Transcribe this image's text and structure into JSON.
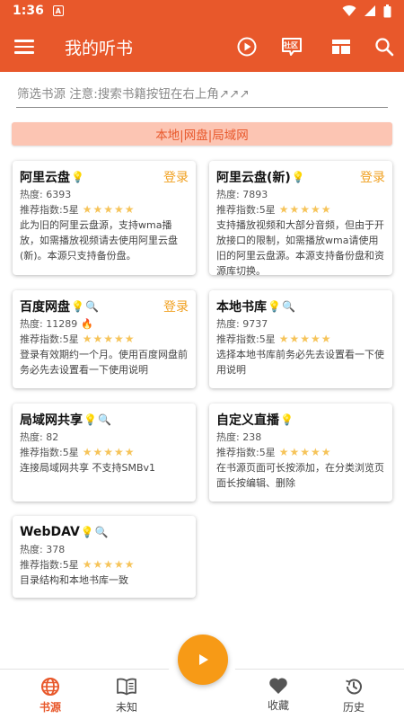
{
  "status": {
    "time": "1:36",
    "notif": "A"
  },
  "appbar": {
    "title": "我的听书",
    "community_label": "社区"
  },
  "filter": {
    "placeholder": "筛选书源 注意:搜索书籍按钮在右上角↗↗↗"
  },
  "banner": {
    "text": "本地|网盘|局域网"
  },
  "cards": [
    {
      "name": "阿里云盘",
      "login": "登录",
      "heat": "热度: 6393",
      "rating": "推荐指数:5星",
      "stars": "★★★★★",
      "desc": "此为旧的阿里云盘源，支持wma播放，如需播放视频请去使用阿里云盘(新)。本源只支持备份盘。"
    },
    {
      "name": "阿里云盘(新)",
      "login": "登录",
      "heat": "热度: 7893",
      "rating": "推荐指数:5星",
      "stars": "★★★★★",
      "desc": "支持播放视频和大部分音频，但由于开放接口的限制，如需播放wma请使用旧的阿里云盘源。本源支持备份盘和资源库切换。"
    },
    {
      "name": "百度网盘",
      "login": "登录",
      "heat": "热度: 11289",
      "rating": "推荐指数:5星",
      "stars": "★★★★★",
      "desc": "登录有效期约一个月。使用百度网盘前务必先去设置看一下使用说明"
    },
    {
      "name": "本地书库",
      "heat": "热度: 9737",
      "rating": "推荐指数:5星",
      "stars": "★★★★★",
      "desc": "选择本地书库前务必先去设置看一下使用说明"
    },
    {
      "name": "局域网共享",
      "heat": "热度: 82",
      "rating": "推荐指数:5星",
      "stars": "★★★★★",
      "desc": "连接局域网共享 不支持SMBv1"
    },
    {
      "name": "自定义直播",
      "heat": "热度: 238",
      "rating": "推荐指数:5星",
      "stars": "★★★★★",
      "desc": "在书源页面可长按添加，在分类浏览页面长按编辑、删除"
    },
    {
      "name": "WebDAV",
      "heat": "热度: 378",
      "rating": "推荐指数:5星",
      "stars": "★★★★★",
      "desc": "目录结构和本地书库一致"
    }
  ],
  "bottomnav": [
    {
      "label": "书源"
    },
    {
      "label": "未知"
    },
    {
      "label": "收藏"
    },
    {
      "label": "历史"
    }
  ],
  "colors": {
    "primary": "#e8582b",
    "accent": "#f79a16",
    "star": "#f6c45a",
    "banner_bg": "#fcc5b3"
  }
}
